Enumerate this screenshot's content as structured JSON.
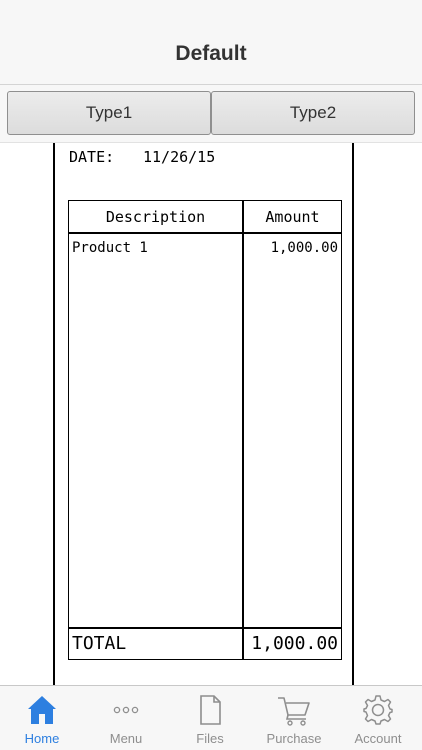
{
  "header": {
    "title": "Default"
  },
  "segments": [
    {
      "label": "Type1"
    },
    {
      "label": "Type2"
    }
  ],
  "receipt": {
    "date_label": "DATE:",
    "date_value": "11/26/15",
    "columns": [
      "Description",
      "Amount"
    ],
    "rows": [
      {
        "description": "Product 1",
        "amount": "1,000.00"
      }
    ],
    "total_label": "TOTAL",
    "total_value": "1,000.00"
  },
  "tabbar": {
    "items": [
      {
        "label": "Home",
        "icon": "home-icon",
        "active": true
      },
      {
        "label": "Menu",
        "icon": "more-dots-icon",
        "active": false
      },
      {
        "label": "Files",
        "icon": "document-icon",
        "active": false
      },
      {
        "label": "Purchase",
        "icon": "cart-icon",
        "active": false
      },
      {
        "label": "Account",
        "icon": "gear-icon",
        "active": false
      }
    ]
  },
  "colors": {
    "accent": "#2d7fe0",
    "inactive": "#8e8e8e"
  }
}
